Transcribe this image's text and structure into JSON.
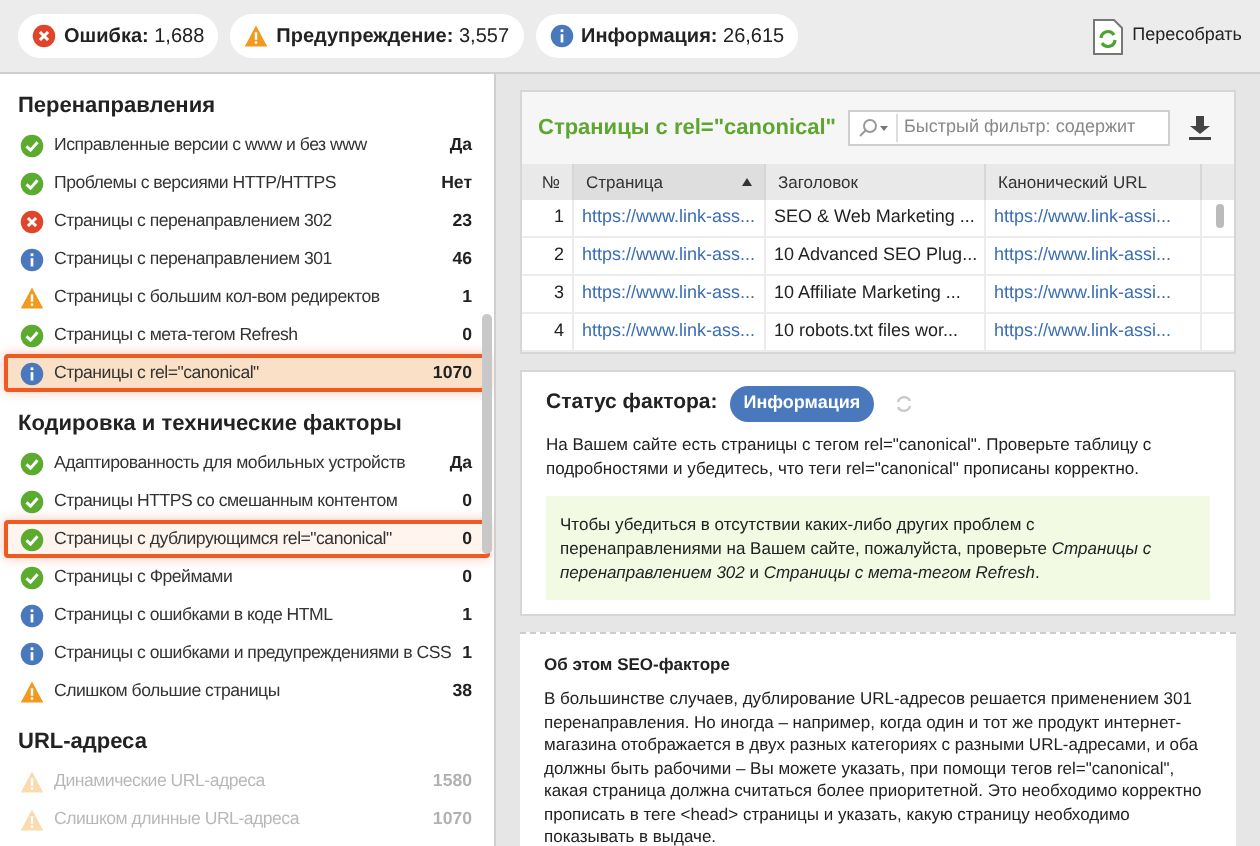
{
  "top_bar": {
    "counters": [
      {
        "kind": "error",
        "label": "Ошибка:",
        "value": "1,688"
      },
      {
        "kind": "warning",
        "label": "Предупреждение:",
        "value": "3,557"
      },
      {
        "kind": "info",
        "label": "Информация:",
        "value": "26,615"
      }
    ],
    "rebuild_button": "Пересобрать"
  },
  "sidebar": {
    "sections": [
      {
        "title": "Перенаправления",
        "items": [
          {
            "kind": "ok",
            "label": "Исправленные версии с www и без www",
            "value": "Да",
            "selected": false,
            "highlighted": false,
            "dimmed": false
          },
          {
            "kind": "ok",
            "label": "Проблемы с версиями HTTP/HTTPS",
            "value": "Нет",
            "selected": false,
            "highlighted": false,
            "dimmed": false
          },
          {
            "kind": "error",
            "label": "Страницы с перенаправлением 302",
            "value": "23",
            "selected": false,
            "highlighted": false,
            "dimmed": false
          },
          {
            "kind": "info",
            "label": "Страницы с перенаправлением 301",
            "value": "46",
            "selected": false,
            "highlighted": false,
            "dimmed": false
          },
          {
            "kind": "warning",
            "label": "Страницы с большим кол-вом редиректов",
            "value": "1",
            "selected": false,
            "highlighted": false,
            "dimmed": false
          },
          {
            "kind": "ok",
            "label": "Страницы с мета-тегом Refresh",
            "value": "0",
            "selected": false,
            "highlighted": false,
            "dimmed": false
          },
          {
            "kind": "info",
            "label": "Страницы с rel=\"canonical\"",
            "value": "1070",
            "selected": true,
            "highlighted": true,
            "dimmed": false
          }
        ]
      },
      {
        "title": "Кодировка и технические факторы",
        "items": [
          {
            "kind": "ok",
            "label": "Адаптированность для мобильных устройств",
            "value": "Да",
            "selected": false,
            "highlighted": false,
            "dimmed": false
          },
          {
            "kind": "ok",
            "label": "Страницы HTTPS со смешанным контентом",
            "value": "0",
            "selected": false,
            "highlighted": false,
            "dimmed": false
          },
          {
            "kind": "ok",
            "label": "Страницы с дублирующимся rel=\"canonical\"",
            "value": "0",
            "selected": false,
            "highlighted": true,
            "dimmed": false
          },
          {
            "kind": "ok",
            "label": "Страницы с Фреймами",
            "value": "0",
            "selected": false,
            "highlighted": false,
            "dimmed": false
          },
          {
            "kind": "info",
            "label": "Страницы с ошибками в коде HTML",
            "value": "1",
            "selected": false,
            "highlighted": false,
            "dimmed": false
          },
          {
            "kind": "info",
            "label": "Страницы с ошибками и предупреждениями в CSS",
            "value": "1",
            "selected": false,
            "highlighted": false,
            "dimmed": false
          },
          {
            "kind": "warning",
            "label": "Слишком большие страницы",
            "value": "38",
            "selected": false,
            "highlighted": false,
            "dimmed": false
          }
        ]
      },
      {
        "title": "URL-адреса",
        "items": [
          {
            "kind": "warning",
            "label": "Динамические URL-адреса",
            "value": "1580",
            "selected": false,
            "highlighted": false,
            "dimmed": true
          },
          {
            "kind": "warning",
            "label": "Слишком длинные URL-адреса",
            "value": "1070",
            "selected": false,
            "highlighted": false,
            "dimmed": true
          }
        ]
      }
    ]
  },
  "table_panel": {
    "title": "Страницы с rel=\"canonical\"",
    "filter": {
      "placeholder": "Быстрый фильтр: содержит"
    },
    "columns": [
      "№",
      "Страница",
      "Заголовок",
      "Канонический URL"
    ],
    "rows": [
      [
        "1",
        "https://www.link-ass...",
        "SEO & Web Marketing ...",
        "https://www.link-assi..."
      ],
      [
        "2",
        "https://www.link-ass...",
        "10 Advanced SEO Plug...",
        "https://www.link-assi..."
      ],
      [
        "3",
        "https://www.link-ass...",
        "10 Affiliate Marketing ...",
        "https://www.link-assi..."
      ],
      [
        "4",
        "https://www.link-ass...",
        "10 robots.txt files wor...",
        "https://www.link-assi..."
      ]
    ]
  },
  "status_panel": {
    "label": "Статус фактора:",
    "status": "Информация",
    "description": "На Вашем сайте есть страницы с тегом rel=\"canonical\". Проверьте таблицу с подробностями и убедитесь, что теги rel=\"canonical\" прописаны корректно.",
    "note": "Чтобы убедиться в отсутствии каких-либо других проблем с перенаправлениями на Вашем сайте, пожалуйста, проверьте *Страницы с перенаправлением 302* и *Страницы с мета-тегом Refresh*."
  },
  "about": {
    "title": "Об этом SEO-факторе",
    "text": "В большинстве случаев, дублирование URL-адресов решается применением 301 перенаправления. Но иногда – например, когда один и тот же продукт интернет-магазина отображается в двух разных категориях с разными URL-адресами, и оба должны быть рабочими – Вы можете указать, при помощи тегов rel=\"canonical\", какая страница должна считаться более приоритетной. Это необходимо корректно прописать в теге <head> страницы и указать, какую страницу необходимо показывать в выдаче."
  }
}
